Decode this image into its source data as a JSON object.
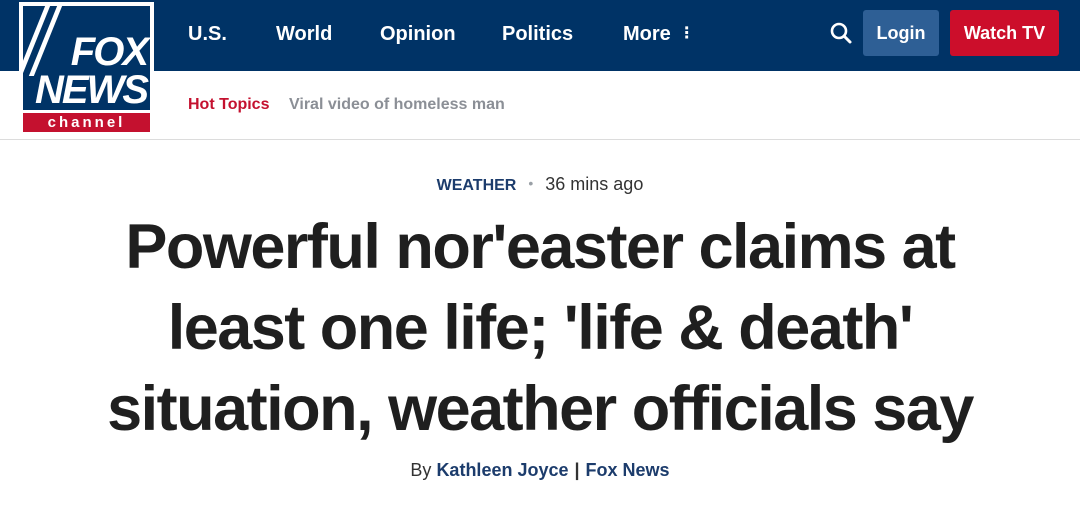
{
  "brand": {
    "logo_line1": "FOX",
    "logo_line2": "NEWS",
    "logo_line3": "channel"
  },
  "nav": {
    "items": [
      {
        "label": "U.S."
      },
      {
        "label": "World"
      },
      {
        "label": "Opinion"
      },
      {
        "label": "Politics"
      },
      {
        "label": "More"
      }
    ],
    "more_icon": "more-vertical-icon",
    "search_icon": "search-icon",
    "login_label": "Login",
    "watch_label": "Watch TV"
  },
  "subnav": {
    "hot_topics_label": "Hot Topics",
    "topics": [
      {
        "label": "Viral video of homeless man"
      }
    ]
  },
  "article": {
    "category": "WEATHER",
    "time_ago": "36 mins ago",
    "headline": "Powerful nor'easter claims at least one life; 'life & death' situation, weather officials say",
    "byline_prefix": "By",
    "author": "Kathleen Joyce",
    "separator": "|",
    "source": "Fox News"
  },
  "colors": {
    "header_bg": "#003366",
    "login_bg": "#2e5f95",
    "watch_bg": "#cc0e2b",
    "hot_topics": "#c4112f",
    "link_navy": "#1c3c6c"
  }
}
